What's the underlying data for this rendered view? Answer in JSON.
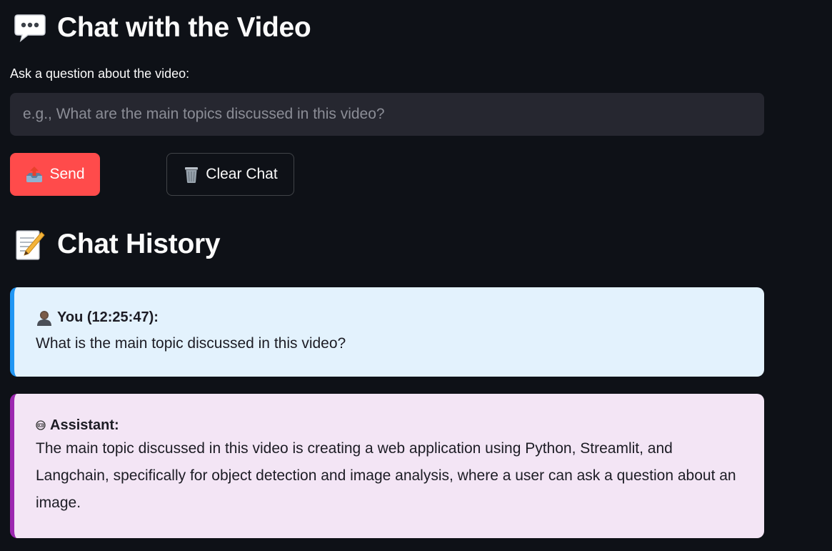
{
  "header": {
    "title": "Chat with the Video",
    "title_icon": "speech-balloon-icon"
  },
  "question": {
    "label": "Ask a question about the video:",
    "value": "",
    "placeholder": "e.g., What are the main topics discussed in this video?"
  },
  "buttons": {
    "send_label": "Send",
    "send_icon": "outbox-tray-icon",
    "clear_label": "Clear Chat",
    "clear_icon": "wastebasket-icon"
  },
  "history": {
    "title": "Chat History",
    "title_icon": "memo-icon",
    "messages": [
      {
        "role": "user",
        "icon": "person-icon",
        "header": "You (12:25:47):",
        "text": "What is the main topic discussed in this video?"
      },
      {
        "role": "assistant",
        "icon": "robot-icon",
        "header": "Assistant:",
        "text": "The main topic discussed in this video is creating a web application using Python, Streamlit, and Langchain, specifically for object detection and image analysis, where a user can ask a question about an image."
      }
    ]
  },
  "colors": {
    "background": "#0e1117",
    "input_bg": "#262730",
    "primary": "#ff4b4b",
    "user_bubble": "#e3f2fd",
    "user_accent": "#2196f3",
    "assistant_bubble": "#f3e5f5",
    "assistant_accent": "#9c27b0"
  }
}
